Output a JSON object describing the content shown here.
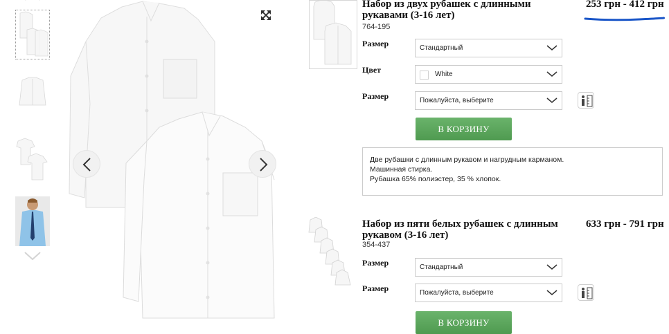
{
  "gallery": {
    "expand_icon": "expand-arrows-icon",
    "prev_icon": "chevron-left-icon",
    "next_icon": "chevron-right-icon",
    "thumbnails": [
      {
        "label": "two shirts"
      },
      {
        "label": "single shirt"
      },
      {
        "label": "short sleeve shirts"
      },
      {
        "label": "model photo"
      }
    ]
  },
  "products": [
    {
      "title_line1": "Набор из двух рубашек с длинными",
      "title_line2": "рукавами (3-16 лет)",
      "code": "764-195",
      "price": "253 грн - 412 грн",
      "options": [
        {
          "label": "Размер",
          "value": "Стандартный"
        },
        {
          "label": "Цвет",
          "value": "White",
          "swatch_color": "#ffffff"
        },
        {
          "label": "Размер",
          "value": "Пожалуйста, выберите"
        }
      ],
      "cart_label": "В КОРЗИНУ",
      "description": [
        "Две рубашки с длинным рукавом и нагрудным карманом.",
        "Машинная стирка.",
        "Рубашка 65% полиэстер, 35 % хлопок."
      ]
    },
    {
      "title_line1": "Набор из пяти белых рубашек с длинным",
      "title_line2": "рукавом (3-16 лет)",
      "code": "354-437",
      "price": "633 грн - 791 грн",
      "options": [
        {
          "label": "Размер",
          "value": "Стандартный"
        },
        {
          "label": "Размер",
          "value": "Пожалуйста, выберите"
        }
      ],
      "cart_label": "В КОРЗИНУ"
    }
  ],
  "colors": {
    "cart_green": "#5aa65b",
    "underline_blue": "#1a56c8"
  }
}
